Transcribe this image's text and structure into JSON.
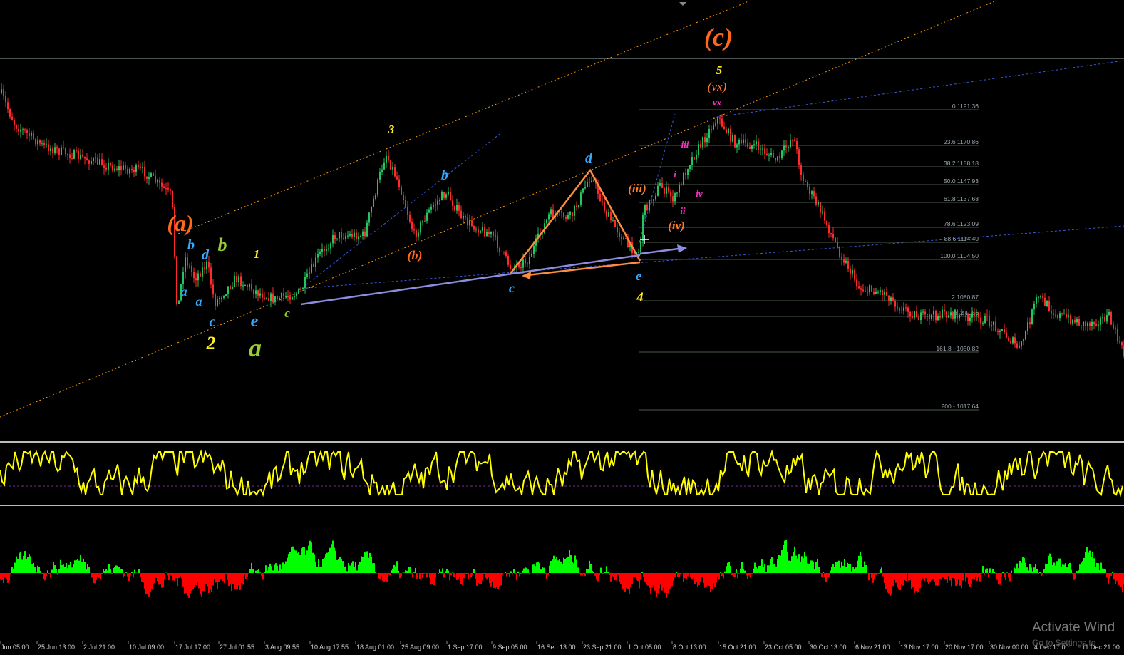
{
  "window": {
    "title": ""
  },
  "colors": {
    "background": "#000000",
    "bull_candle": "#22c55e",
    "bear_candle": "#ff2a2a",
    "oscillator": "#ffff00",
    "histogram_up": "#00ff00",
    "histogram_down": "#ff0000",
    "fib_line": "#4a5a4a",
    "fib_text": "#9aa6b0",
    "channel": "#ff9900",
    "blue_dash": "#3a5ad8",
    "triangle_arrow": "#ff8c3c",
    "trendline": "#8c8ce0"
  },
  "time_axis": [
    "Jun 05:00",
    "25 Jun 13:00",
    "2 Jul 21:00",
    "10 Jul 09:00",
    "17 Jul 17:00",
    "27 Jul 01:55",
    "3 Aug 09:55",
    "10 Aug 17:55",
    "18 Aug 01:00",
    "25 Aug 09:00",
    "1 Sep 17:00",
    "9 Sep 05:00",
    "16 Sep 13:00",
    "23 Sep 21:00",
    "1 Oct 05:00",
    "8 Oct 13:00",
    "15 Oct 21:00",
    "23 Oct 05:00",
    "30 Oct 13:00",
    "6 Nov 21:00",
    "13 Nov 17:00",
    "20 Nov 17:00",
    "30 Nov 00:00",
    "4 Dec 17:00",
    "11 Dec 21:00"
  ],
  "fib_levels": [
    "0 1191.36",
    "23.6 1170.86",
    "38.2 1158.18",
    "50.0 1147.93",
    "61.8 1137.68",
    "78.6 1123.09",
    "88.6 1114.40",
    "100.0 1104.50",
    "2 1080.87",
    "38.2 1066",
    "161.8 - 1050.82",
    "200 - 1017.64"
  ],
  "wave_labels": [
    {
      "text": "(c)",
      "color": "#ff6a1a"
    },
    {
      "text": "5",
      "color": "#ffee22"
    },
    {
      "text": "(vx)",
      "color": "#ff7a2a"
    },
    {
      "text": "vx",
      "color": "#ff33cc"
    },
    {
      "text": "3",
      "color": "#ffee22"
    },
    {
      "text": "d",
      "color": "#33aaff"
    },
    {
      "text": "b",
      "color": "#33aaff"
    },
    {
      "text": "iii",
      "color": "#ff33cc"
    },
    {
      "text": "i",
      "color": "#ff33cc"
    },
    {
      "text": "(iii)",
      "color": "#ff7a2a"
    },
    {
      "text": "iv",
      "color": "#ff33cc"
    },
    {
      "text": "ii",
      "color": "#ff33cc"
    },
    {
      "text": "(iv)",
      "color": "#ff7a2a"
    },
    {
      "text": "(a)",
      "color": "#ff6a1a"
    },
    {
      "text": "b",
      "color": "#33aaff"
    },
    {
      "text": "d",
      "color": "#33aaff"
    },
    {
      "text": "b",
      "color": "#9acd32"
    },
    {
      "text": "1",
      "color": "#ffee22"
    },
    {
      "text": "a",
      "color": "#33aaff"
    },
    {
      "text": "a",
      "color": "#33aaff"
    },
    {
      "text": "c",
      "color": "#33aaff"
    },
    {
      "text": "e",
      "color": "#33aaff"
    },
    {
      "text": "c",
      "color": "#9acd32"
    },
    {
      "text": "2",
      "color": "#ffee22"
    },
    {
      "text": "a",
      "color": "#9acd32"
    },
    {
      "text": "(b)",
      "color": "#ff6a1a"
    },
    {
      "text": "c",
      "color": "#33aaff"
    },
    {
      "text": "e",
      "color": "#33aaff"
    },
    {
      "text": "4",
      "color": "#ffee22"
    }
  ],
  "watermark": {
    "line1": "Activate Wind",
    "line2": "Go to Settings to"
  }
}
